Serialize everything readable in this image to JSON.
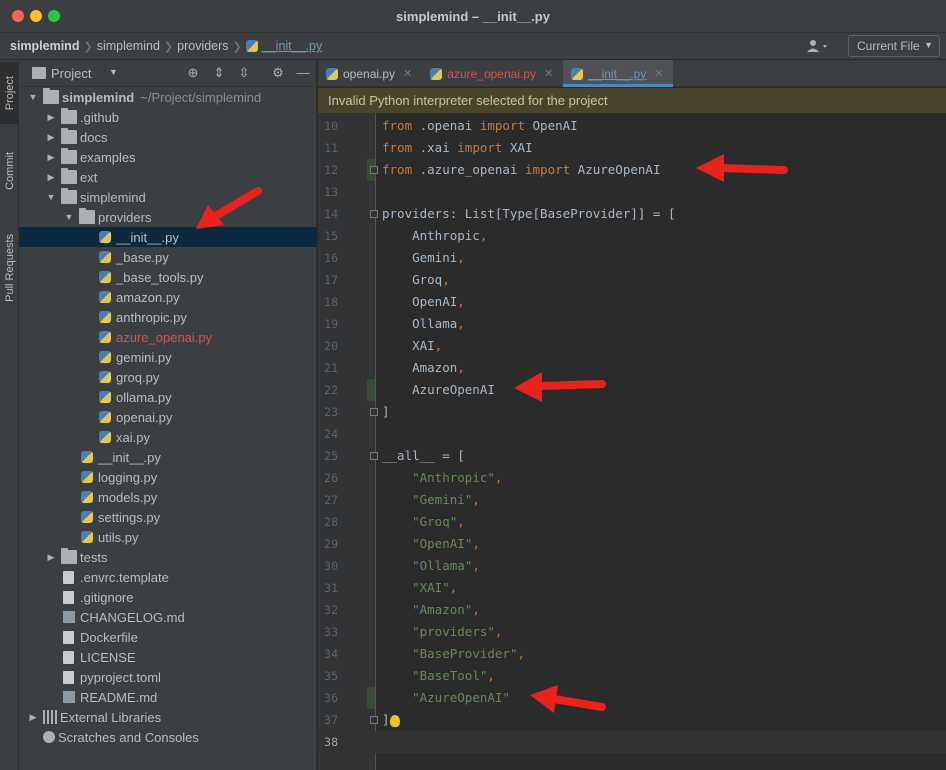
{
  "window": {
    "title": "simplemind – __init__.py"
  },
  "navbar": {
    "breadcrumb": [
      "simplemind",
      "simplemind",
      "providers",
      "__init__.py"
    ],
    "current_file_label": "Current File"
  },
  "left_strip": {
    "tabs": [
      "Project",
      "Commit",
      "Pull Requests"
    ]
  },
  "project_panel": {
    "title": "Project",
    "tree": [
      {
        "label": "simplemind",
        "path": "~/Project/simplemind",
        "type": "folder",
        "depth": 0,
        "expanded": true
      },
      {
        "label": ".github",
        "type": "folder",
        "depth": 1,
        "expanded": false
      },
      {
        "label": "docs",
        "type": "folder",
        "depth": 1,
        "expanded": false
      },
      {
        "label": "examples",
        "type": "folder",
        "depth": 1,
        "expanded": false
      },
      {
        "label": "ext",
        "type": "folder",
        "depth": 1,
        "expanded": false
      },
      {
        "label": "simplemind",
        "type": "folder",
        "depth": 1,
        "expanded": true
      },
      {
        "label": "providers",
        "type": "folder",
        "depth": 2,
        "expanded": true
      },
      {
        "label": "__init__.py",
        "type": "py",
        "depth": 3,
        "selected": true
      },
      {
        "label": "_base.py",
        "type": "py",
        "depth": 3
      },
      {
        "label": "_base_tools.py",
        "type": "py",
        "depth": 3
      },
      {
        "label": "amazon.py",
        "type": "py",
        "depth": 3
      },
      {
        "label": "anthropic.py",
        "type": "py",
        "depth": 3
      },
      {
        "label": "azure_openai.py",
        "type": "py",
        "depth": 3,
        "modified": true
      },
      {
        "label": "gemini.py",
        "type": "py",
        "depth": 3
      },
      {
        "label": "groq.py",
        "type": "py",
        "depth": 3
      },
      {
        "label": "ollama.py",
        "type": "py",
        "depth": 3
      },
      {
        "label": "openai.py",
        "type": "py",
        "depth": 3
      },
      {
        "label": "xai.py",
        "type": "py",
        "depth": 3
      },
      {
        "label": "__init__.py",
        "type": "py",
        "depth": 2
      },
      {
        "label": "logging.py",
        "type": "py",
        "depth": 2
      },
      {
        "label": "models.py",
        "type": "py",
        "depth": 2
      },
      {
        "label": "settings.py",
        "type": "py",
        "depth": 2
      },
      {
        "label": "utils.py",
        "type": "py",
        "depth": 2
      },
      {
        "label": "tests",
        "type": "folder",
        "depth": 1,
        "expanded": false
      },
      {
        "label": ".envrc.template",
        "type": "file",
        "depth": 1
      },
      {
        "label": ".gitignore",
        "type": "file",
        "depth": 1
      },
      {
        "label": "CHANGELOG.md",
        "type": "md",
        "depth": 1
      },
      {
        "label": "Dockerfile",
        "type": "file",
        "depth": 1
      },
      {
        "label": "LICENSE",
        "type": "file",
        "depth": 1
      },
      {
        "label": "pyproject.toml",
        "type": "file",
        "depth": 1
      },
      {
        "label": "README.md",
        "type": "md",
        "depth": 1
      },
      {
        "label": "External Libraries",
        "type": "lib",
        "depth": 0,
        "expanded": false
      },
      {
        "label": "Scratches and Consoles",
        "type": "scratch",
        "depth": 0
      }
    ]
  },
  "tabs": [
    {
      "label": "openai.py",
      "active": false,
      "modified": false
    },
    {
      "label": "azure_openai.py",
      "active": false,
      "modified": true
    },
    {
      "label": "__init__.py",
      "active": true,
      "modified": false
    }
  ],
  "banner": {
    "text": "Invalid Python interpreter selected for the project"
  },
  "editor": {
    "lines": [
      {
        "n": "10",
        "tokens": [
          [
            "kw",
            "from"
          ],
          [
            "ident",
            " .openai "
          ],
          [
            "kw",
            "import"
          ],
          [
            "ident",
            " OpenAI"
          ]
        ]
      },
      {
        "n": "11",
        "tokens": [
          [
            "kw",
            "from"
          ],
          [
            "ident",
            " .xai "
          ],
          [
            "kw",
            "import"
          ],
          [
            "ident",
            " XAI"
          ]
        ]
      },
      {
        "n": "12",
        "tokens": [
          [
            "kw",
            "from"
          ],
          [
            "ident",
            " .azure_openai "
          ],
          [
            "kw",
            "import"
          ],
          [
            "ident",
            " AzureOpenAI"
          ]
        ]
      },
      {
        "n": "13",
        "tokens": []
      },
      {
        "n": "14",
        "tokens": [
          [
            "ident",
            "providers: List[Type[BaseProvider]] = ["
          ]
        ]
      },
      {
        "n": "15",
        "tokens": [
          [
            "ident",
            "    Anthropic"
          ],
          [
            "punc",
            ","
          ]
        ]
      },
      {
        "n": "16",
        "tokens": [
          [
            "ident",
            "    Gemini"
          ],
          [
            "punc",
            ","
          ]
        ]
      },
      {
        "n": "17",
        "tokens": [
          [
            "ident",
            "    Groq"
          ],
          [
            "punc",
            ","
          ]
        ]
      },
      {
        "n": "18",
        "tokens": [
          [
            "ident",
            "    OpenAI"
          ],
          [
            "punc",
            ","
          ]
        ]
      },
      {
        "n": "19",
        "tokens": [
          [
            "ident",
            "    Ollama"
          ],
          [
            "punc",
            ","
          ]
        ]
      },
      {
        "n": "20",
        "tokens": [
          [
            "ident",
            "    XAI"
          ],
          [
            "punc",
            ","
          ]
        ]
      },
      {
        "n": "21",
        "tokens": [
          [
            "ident",
            "    Amazon"
          ],
          [
            "punc",
            ","
          ]
        ]
      },
      {
        "n": "22",
        "tokens": [
          [
            "ident",
            "    AzureOpenAI"
          ]
        ]
      },
      {
        "n": "23",
        "tokens": [
          [
            "ident",
            "]"
          ]
        ]
      },
      {
        "n": "24",
        "tokens": []
      },
      {
        "n": "25",
        "tokens": [
          [
            "ident",
            "__all__ = ["
          ]
        ]
      },
      {
        "n": "26",
        "tokens": [
          [
            "ident",
            "    "
          ],
          [
            "str",
            "\"Anthropic\""
          ],
          [
            "punc",
            ","
          ]
        ]
      },
      {
        "n": "27",
        "tokens": [
          [
            "ident",
            "    "
          ],
          [
            "str",
            "\"Gemini\""
          ],
          [
            "punc",
            ","
          ]
        ]
      },
      {
        "n": "28",
        "tokens": [
          [
            "ident",
            "    "
          ],
          [
            "str",
            "\"Groq\""
          ],
          [
            "punc",
            ","
          ]
        ]
      },
      {
        "n": "29",
        "tokens": [
          [
            "ident",
            "    "
          ],
          [
            "str",
            "\"OpenAI\""
          ],
          [
            "punc",
            ","
          ]
        ]
      },
      {
        "n": "30",
        "tokens": [
          [
            "ident",
            "    "
          ],
          [
            "str",
            "\"Ollama\""
          ],
          [
            "punc",
            ","
          ]
        ]
      },
      {
        "n": "31",
        "tokens": [
          [
            "ident",
            "    "
          ],
          [
            "str",
            "\"XAI\""
          ],
          [
            "punc",
            ","
          ]
        ]
      },
      {
        "n": "32",
        "tokens": [
          [
            "ident",
            "    "
          ],
          [
            "str",
            "\"Amazon\""
          ],
          [
            "punc",
            ","
          ]
        ]
      },
      {
        "n": "33",
        "tokens": [
          [
            "ident",
            "    "
          ],
          [
            "str",
            "\"providers\""
          ],
          [
            "punc",
            ","
          ]
        ]
      },
      {
        "n": "34",
        "tokens": [
          [
            "ident",
            "    "
          ],
          [
            "str",
            "\"BaseProvider\""
          ],
          [
            "punc",
            ","
          ]
        ]
      },
      {
        "n": "35",
        "tokens": [
          [
            "ident",
            "    "
          ],
          [
            "str",
            "\"BaseTool\""
          ],
          [
            "punc",
            ","
          ]
        ]
      },
      {
        "n": "36",
        "tokens": [
          [
            "ident",
            "    "
          ],
          [
            "str",
            "\"AzureOpenAI\""
          ]
        ]
      },
      {
        "n": "37",
        "tokens": [
          [
            "ident",
            "]"
          ]
        ]
      },
      {
        "n": "38",
        "tokens": [],
        "current": true
      }
    ]
  },
  "colors": {
    "annotation_arrow": "#e8231c",
    "accent": "#4a88c7",
    "keyword": "#cc7832",
    "string": "#6a8759"
  }
}
